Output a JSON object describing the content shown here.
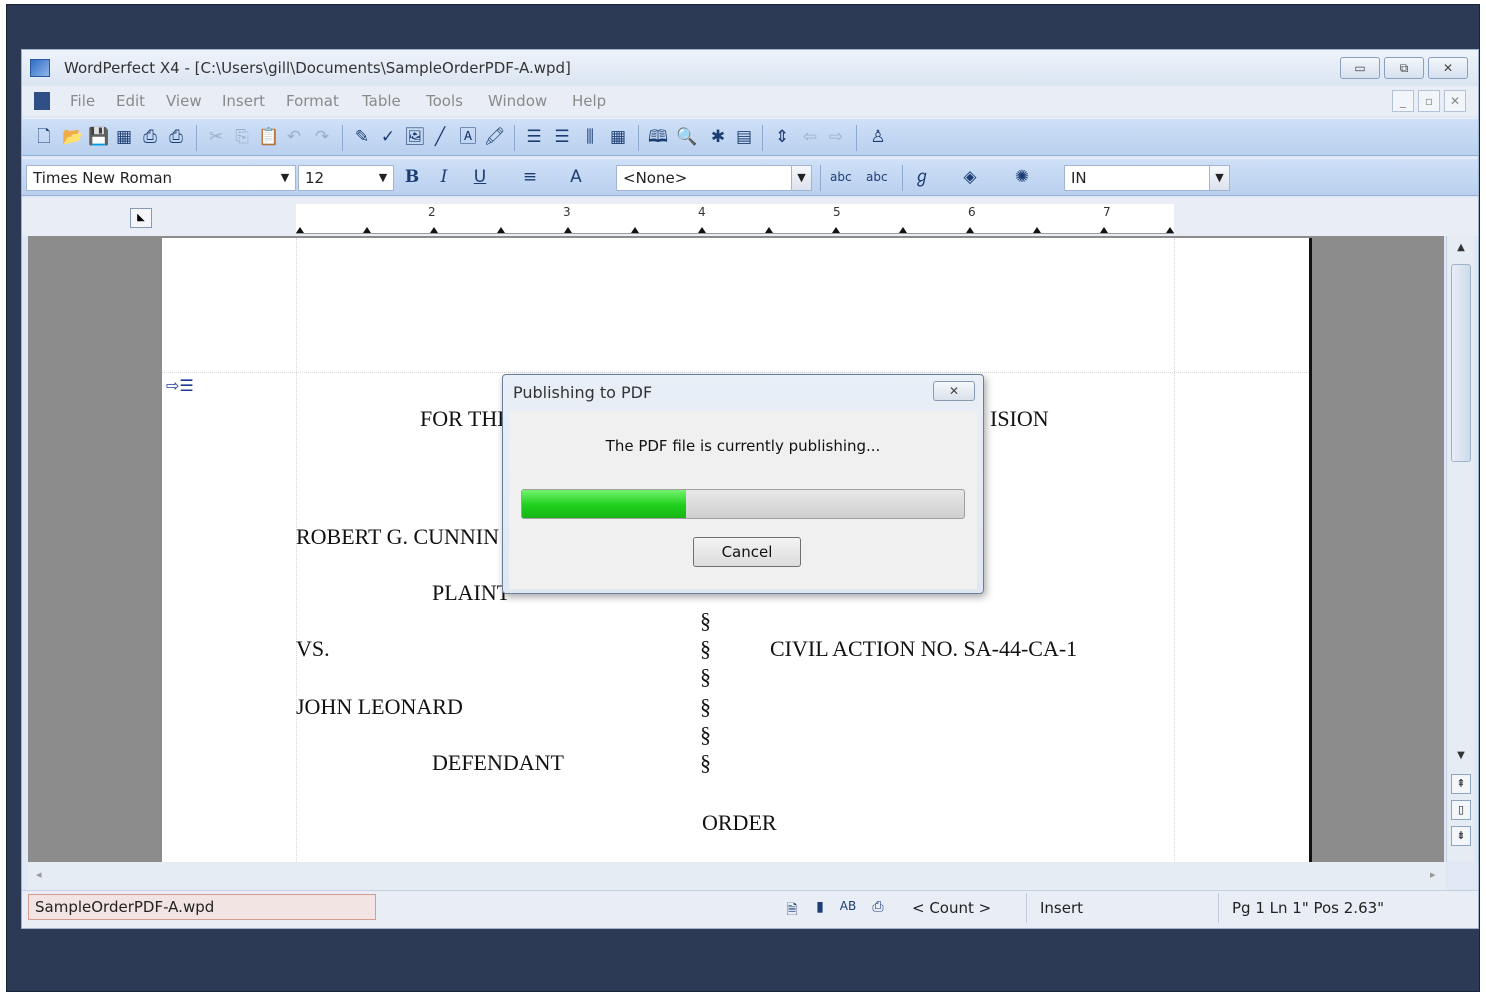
{
  "window": {
    "title": "WordPerfect X4 - [C:\\Users\\gill\\Documents\\SampleOrderPDF-A.wpd]",
    "controls": [
      "▭",
      "⧉",
      "✕"
    ]
  },
  "menu": {
    "items": [
      "File",
      "Edit",
      "View",
      "Insert",
      "Format",
      "Table",
      "Tools",
      "Window",
      "Help"
    ],
    "mdi_controls": [
      "_",
      "▫",
      "✕"
    ]
  },
  "property_bar": {
    "font": "Times New Roman",
    "size": "12",
    "style": "<None>",
    "units": "IN"
  },
  "ruler": {
    "numbers": [
      "2",
      "3",
      "4",
      "5",
      "6",
      "7"
    ]
  },
  "document": {
    "lines": {
      "for_the": "FOR THE",
      "division_fragment": "ISION",
      "plaintiff_name": "ROBERT G. CUNNIN",
      "plaintiff_label": "PLAINT",
      "vs": "VS.",
      "case_no": "CIVIL ACTION NO. SA-44-CA-1",
      "defendant_name": "JOHN LEONARD",
      "defendant_label": "DEFENDANT",
      "order": "ORDER",
      "section_sign": "§"
    }
  },
  "dialog": {
    "title": "Publishing to PDF",
    "close_label": "✕",
    "message": "The PDF file is currently publishing...",
    "progress_fraction": 0.37,
    "cancel_label": "Cancel"
  },
  "status_bar": {
    "filename": "SampleOrderPDF-A.wpd",
    "count": "< Count >",
    "mode": "Insert",
    "position": "Pg 1 Ln 1\" Pos 2.63\""
  },
  "colors": {
    "accent": "#b9d0ef",
    "progress": "#1fcf1c",
    "frame": "#2c3a55"
  }
}
